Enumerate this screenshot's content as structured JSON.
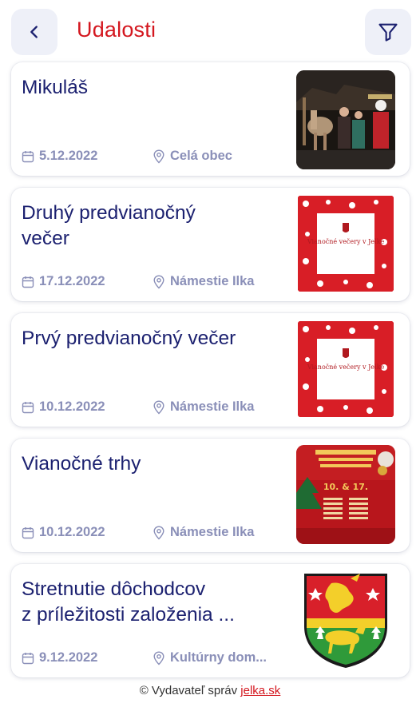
{
  "header": {
    "title": "Udalosti",
    "back_icon": "chevron-left-icon",
    "filter_icon": "filter-icon",
    "title_color": "#d4171f"
  },
  "events": [
    {
      "title_line1": "Mikuláš",
      "title_line2": "",
      "date": "5.12.2022",
      "location": "Celá obec",
      "image": "photo-night-horse-carriage-santa"
    },
    {
      "title_line1": "Druhý predvianočný",
      "title_line2": "večer",
      "date": "17.12.2022",
      "location": "Námestie Ilka",
      "image": "red-christmas-pattern-poster",
      "poster_text": "Vianočné večery v Jelke"
    },
    {
      "title_line1": "Prvý predvianočný večer",
      "title_line2": "",
      "date": "10.12.2022",
      "location": "Námestie Ilka",
      "image": "red-christmas-pattern-poster",
      "poster_text": "Vianočné večery v Jelke"
    },
    {
      "title_line1": "Vianočné trhy",
      "title_line2": "",
      "date": "10.12.2022",
      "location": "Námestie Ilka",
      "image": "christmas-market-poster",
      "poster_text": "10. & 17."
    },
    {
      "title_line1": "Stretnutie dôchodcov",
      "title_line2": "z príležitosti založenia ...",
      "date": "9.12.2022",
      "location": "Kultúrny dom...",
      "image": "municipal-coat-of-arms"
    }
  ],
  "meta_icons": {
    "date": "calendar-icon",
    "location": "location-pin-icon"
  },
  "footer": {
    "prefix": "© Vydavateľ správ ",
    "link": "jelka.sk"
  }
}
